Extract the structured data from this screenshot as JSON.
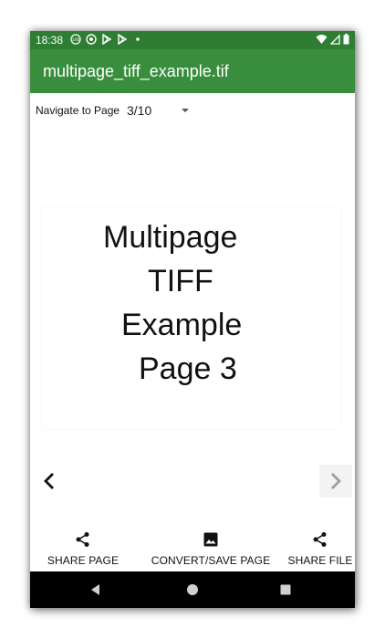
{
  "status_bar": {
    "time": "18:38",
    "left_icons": [
      "data-saver-icon",
      "sync-circle-icon",
      "play-store-icon",
      "play-store-icon",
      "dot-icon"
    ],
    "right_icons": [
      "wifi-icon",
      "signal-icon",
      "battery-icon"
    ]
  },
  "app_bar": {
    "title": "multipage_tiff_example.tif",
    "color": "#388e3c",
    "status_color": "#2e7d32"
  },
  "navigator": {
    "label": "Navigate to Page",
    "selected_page": "3/10"
  },
  "document": {
    "lines": [
      "Multipage",
      "TIFF",
      "Example",
      "Page 3"
    ]
  },
  "actions": [
    {
      "label": "SHARE PAGE",
      "icon": "share-icon"
    },
    {
      "label": "CONVERT/SAVE PAGE",
      "icon": "image-icon"
    },
    {
      "label": "SHARE FILE",
      "icon": "share-icon"
    }
  ],
  "system_nav": [
    "back-icon",
    "home-icon",
    "recents-icon"
  ]
}
